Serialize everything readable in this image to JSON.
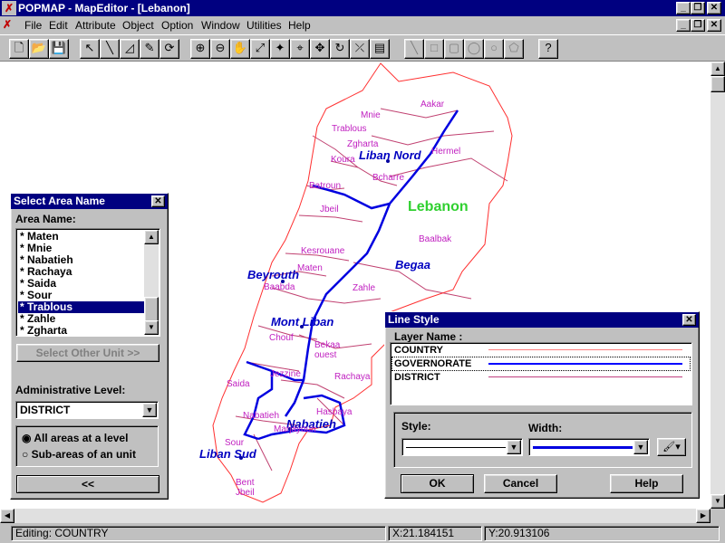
{
  "title": "POPMAP - MapEditor - [Lebanon]",
  "window_buttons": [
    "_",
    "❐",
    "✕"
  ],
  "menu": [
    "File",
    "Edit",
    "Attribute",
    "Object",
    "Option",
    "Window",
    "Utilities",
    "Help"
  ],
  "map": {
    "country_label": "Lebanon",
    "governorates": [
      "Liban Nord",
      "Beyrouth",
      "Begaa",
      "Mont Liban",
      "Nabatieh",
      "Liban Sud"
    ],
    "districts": [
      "Aakar",
      "Mnie",
      "Trablous",
      "Zgharta",
      "Hermel",
      "Koura",
      "Bcharre",
      "Batroun",
      "Jbeil",
      "Baalbak",
      "Kesrouane",
      "Maten",
      "Baabda",
      "Zahle",
      "Chouf",
      "Bekaa ouest",
      "Jezzine",
      "Rachaya",
      "Saida",
      "Nabatieh",
      "Hasbaya",
      "Marjayoun",
      "Sour",
      "Bent Jbeil"
    ]
  },
  "select_area": {
    "title": "Select Area Name",
    "area_name_label": "Area Name:",
    "items": [
      "* Maten",
      "* Mnie",
      "* Nabatieh",
      "* Rachaya",
      "* Saida",
      "* Sour",
      "* Trablous",
      "* Zahle",
      "* Zgharta"
    ],
    "selected": "* Trablous",
    "select_other_unit": "Select Other Unit  >>",
    "admin_level_label": "Administrative Level:",
    "admin_level_value": "DISTRICT",
    "radio_all": "All areas at a level",
    "radio_sub": "Sub-areas of an unit",
    "back_button": "<<"
  },
  "line_style": {
    "title": "Line Style",
    "layer_name_label": "Layer Name :",
    "layers": [
      {
        "name": "COUNTRY",
        "color": "#ff8080"
      },
      {
        "name": "GOVERNORATE",
        "color": "#0000ff"
      },
      {
        "name": "DISTRICT",
        "color": "#c04080"
      }
    ],
    "selected_layer": "GOVERNORATE",
    "style_label": "Style:",
    "width_label": "Width:",
    "ok_label": "OK",
    "cancel_label": "Cancel",
    "help_label": "Help"
  },
  "status": {
    "editing": "Editing: COUNTRY",
    "x": "X:21.184151",
    "y": "Y:20.913106"
  }
}
